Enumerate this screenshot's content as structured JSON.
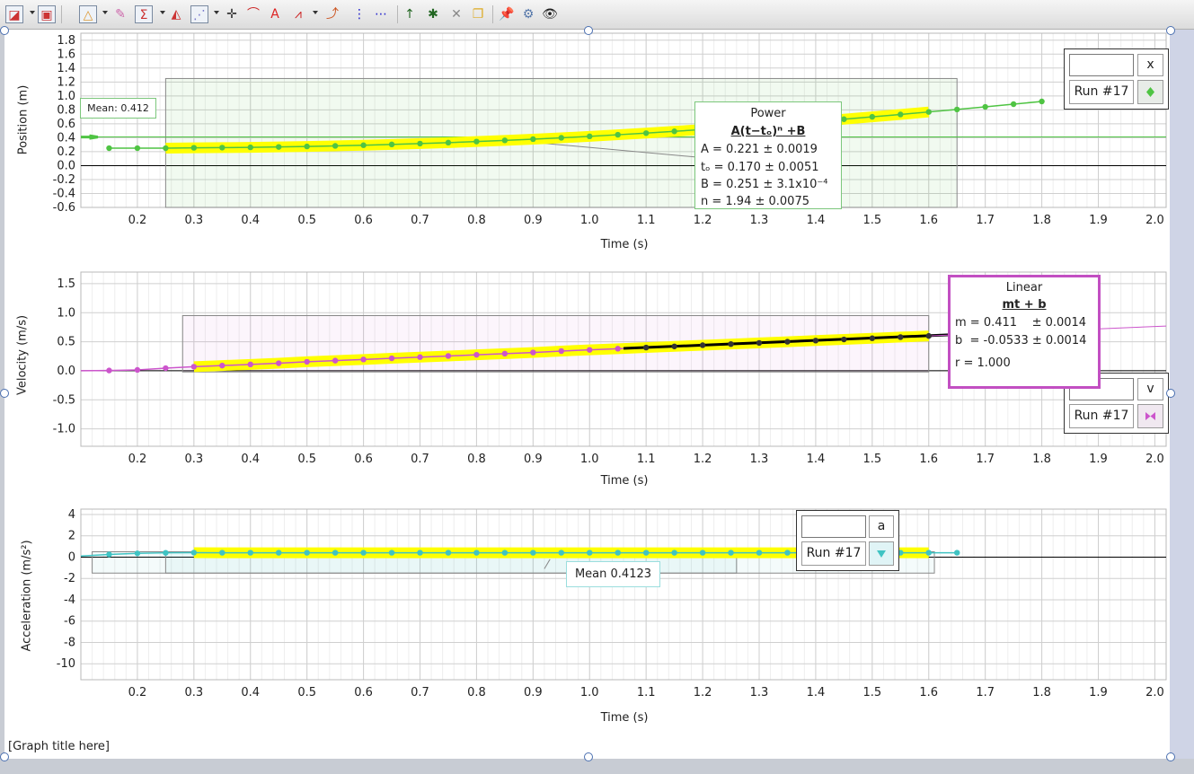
{
  "toolbar": {
    "icons": [
      "new-graph-icon",
      "graph-layout-icon",
      "graph-options-icon",
      "highlighter-icon",
      "statistics-icon",
      "integral-icon",
      "curve-fit-icon",
      "examine-icon",
      "tangent-icon",
      "annotation-icon",
      "fft-icon",
      "slope-icon",
      "interpolate-icon",
      "delta-icon",
      "strike-through-icon",
      "delete-icon",
      "duplicate-icon",
      "pin-icon",
      "settings-icon",
      "eye-icon"
    ]
  },
  "graph_title": "[Graph title here]",
  "charts": {
    "position": {
      "ylabel": "Position (m)",
      "xlabel": "Time (s)",
      "mean_label": "Mean: 0.412",
      "fit": {
        "type": "Power",
        "equation": "A(t−tₒ)ⁿ +B",
        "params": [
          "A  = 0.221 ± 0.0019",
          "tₒ = 0.170 ± 0.0051",
          "B  = 0.251 ± 3.1x10⁻⁴",
          "n  = 1.94   ± 0.0075"
        ]
      },
      "key": {
        "field": "",
        "var": "x",
        "run": "Run #17",
        "color": "#4fc443"
      }
    },
    "velocity": {
      "ylabel": "Velocity (m/s)",
      "xlabel": "Time (s)",
      "fit": {
        "type": "Linear",
        "equation": "mt + b",
        "params": [
          "m = 0.411    ± 0.0014",
          "b  = -0.0533 ± 0.0014",
          "r = 1.000"
        ]
      },
      "key": {
        "field": "",
        "var": "v",
        "run": "Run #17",
        "color": "#cc55cc"
      }
    },
    "acceleration": {
      "ylabel": "Acceleration (m/s²)",
      "xlabel": "Time (s)",
      "mean_label": "Mean 0.4123",
      "key": {
        "field": "",
        "var": "a",
        "run": "Run #17",
        "color": "#3fc3c3"
      }
    }
  },
  "chart_data": [
    {
      "type": "line",
      "ylabel": "Position (m)",
      "xlabel": "Time (s)",
      "xlim": [
        0.1,
        2.02
      ],
      "ylim": [
        -0.6,
        1.9
      ],
      "xticks": [
        "0.2",
        "0.3",
        "0.4",
        "0.5",
        "0.6",
        "0.7",
        "0.8",
        "0.9",
        "1.0",
        "1.1",
        "1.2",
        "1.3",
        "1.4",
        "1.5",
        "1.6",
        "1.7",
        "1.8",
        "1.9",
        "2.0"
      ],
      "yticks": [
        "1.8",
        "1.6",
        "1.4",
        "1.2",
        "1.0",
        "0.8",
        "0.6",
        "0.4",
        "0.2",
        "0.0",
        "-0.2",
        "-0.4",
        "-0.6"
      ],
      "series": [
        {
          "name": "Run #17",
          "color": "#4fc443",
          "x": [
            0.15,
            0.2,
            0.25,
            0.3,
            0.35,
            0.4,
            0.45,
            0.5,
            0.55,
            0.6,
            0.65,
            0.7,
            0.75,
            0.8,
            0.85,
            0.9,
            0.95,
            1.0,
            1.05,
            1.1,
            1.15,
            1.2,
            1.25,
            1.3,
            1.35,
            1.4,
            1.45,
            1.5,
            1.55,
            1.6,
            1.65,
            1.7,
            1.75,
            1.8
          ],
          "values": [
            0.25,
            0.25,
            0.25,
            0.256,
            0.258,
            0.262,
            0.268,
            0.275,
            0.283,
            0.293,
            0.304,
            0.316,
            0.33,
            0.345,
            0.362,
            0.38,
            0.399,
            0.42,
            0.443,
            0.466,
            0.492,
            0.518,
            0.545,
            0.574,
            0.603,
            0.634,
            0.666,
            0.7,
            0.734,
            0.77,
            0.806,
            0.843,
            0.882,
            0.921
          ]
        }
      ]
    },
    {
      "type": "line",
      "ylabel": "Velocity (m/s)",
      "xlabel": "Time (s)",
      "xlim": [
        0.1,
        2.02
      ],
      "ylim": [
        -1.3,
        1.7
      ],
      "xticks": [
        "0.2",
        "0.3",
        "0.4",
        "0.5",
        "0.6",
        "0.7",
        "0.8",
        "0.9",
        "1.0",
        "1.1",
        "1.2",
        "1.3",
        "1.4",
        "1.5",
        "1.6",
        "1.7",
        "1.8",
        "1.9",
        "2.0"
      ],
      "yticks": [
        "1.5",
        "1.0",
        "0.5",
        "0.0",
        "-0.5",
        "-1.0"
      ],
      "series": [
        {
          "name": "Run #17",
          "color": "#cc55cc",
          "x": [
            0.15,
            0.2,
            0.25,
            0.3,
            0.35,
            0.4,
            0.45,
            0.5,
            0.55,
            0.6,
            0.65,
            0.7,
            0.75,
            0.8,
            0.85,
            0.9,
            0.95,
            1.0,
            1.05,
            1.1,
            1.15,
            1.2,
            1.25,
            1.3,
            1.35,
            1.4,
            1.45,
            1.5,
            1.55,
            1.6
          ],
          "values": [
            0.005,
            0.015,
            0.045,
            0.07,
            0.09,
            0.11,
            0.13,
            0.155,
            0.175,
            0.195,
            0.215,
            0.235,
            0.255,
            0.275,
            0.295,
            0.315,
            0.34,
            0.36,
            0.38,
            0.4,
            0.42,
            0.44,
            0.46,
            0.48,
            0.5,
            0.52,
            0.54,
            0.56,
            0.58,
            0.6
          ]
        }
      ]
    },
    {
      "type": "line",
      "ylabel": "Acceleration (m/s²)",
      "xlabel": "Time (s)",
      "xlim": [
        0.1,
        2.02
      ],
      "ylim": [
        -11.5,
        4.5
      ],
      "xticks": [
        "0.2",
        "0.3",
        "0.4",
        "0.5",
        "0.6",
        "0.7",
        "0.8",
        "0.9",
        "1.0",
        "1.1",
        "1.2",
        "1.3",
        "1.4",
        "1.5",
        "1.6",
        "1.7",
        "1.8",
        "1.9",
        "2.0"
      ],
      "yticks": [
        "4",
        "2",
        "0",
        "-2",
        "-4",
        "-6",
        "-8",
        "-10"
      ],
      "series": [
        {
          "name": "Run #17",
          "color": "#3fc3c3",
          "x": [
            0.15,
            0.2,
            0.25,
            0.3,
            0.35,
            0.4,
            0.45,
            0.5,
            0.55,
            0.6,
            0.65,
            0.7,
            0.75,
            0.8,
            0.85,
            0.9,
            0.95,
            1.0,
            1.05,
            1.1,
            1.15,
            1.2,
            1.25,
            1.3,
            1.35,
            1.4,
            1.45,
            1.5,
            1.55,
            1.6,
            1.65
          ],
          "values": [
            0.25,
            0.35,
            0.4,
            0.42,
            0.41,
            0.41,
            0.41,
            0.41,
            0.41,
            0.41,
            0.41,
            0.41,
            0.41,
            0.41,
            0.41,
            0.41,
            0.41,
            0.41,
            0.41,
            0.41,
            0.41,
            0.41,
            0.41,
            0.41,
            0.41,
            0.41,
            0.41,
            0.41,
            0.41,
            0.41,
            0.41
          ]
        }
      ]
    }
  ]
}
